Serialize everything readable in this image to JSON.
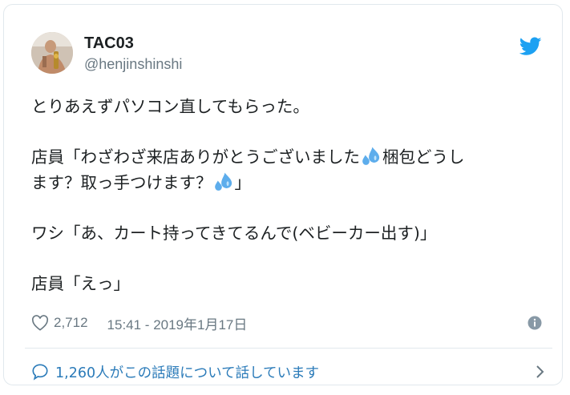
{
  "user": {
    "display_name": "TAC03",
    "screen_name": "@henjinshinshi"
  },
  "tweet": {
    "line1": "とりあえずパソコン直してもらった。",
    "line2a": "店員「わざわざ来店ありがとうございました",
    "line2b": "梱包どうし",
    "line3a": "ます？取っ手つけます？",
    "line3b": "」",
    "line4": "ワシ「あ、カート持ってきてるんで(ベビーカー出す)」",
    "line5": "店員「えっ」"
  },
  "meta": {
    "likes": "2,712",
    "timestamp": "15:41 - 2019年1月17日"
  },
  "footer": {
    "talk_text": "1,260人がこの話題について話しています"
  },
  "icons": {
    "bird": "twitter-bird-icon",
    "heart": "heart-icon",
    "info": "info-icon",
    "chat": "chat-bubble-icon",
    "chevron": "chevron-right-icon",
    "emoji": "sweat-droplets-emoji"
  },
  "colors": {
    "accent": "#1da1f2",
    "link": "#2b7bb9",
    "text": "#1c2022",
    "muted": "#697882",
    "border": "#e1e8ed"
  }
}
